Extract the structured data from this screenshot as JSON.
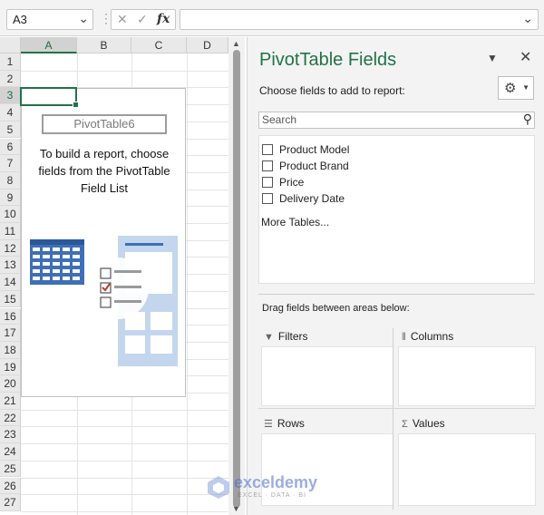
{
  "formula_bar": {
    "name_box": "A3",
    "cancel_icon": "x-icon",
    "enter_icon": "check-icon",
    "fx_label": "fx",
    "formula_value": ""
  },
  "sheet": {
    "columns": [
      "A",
      "B",
      "C",
      "D"
    ],
    "rows": [
      "1",
      "2",
      "3",
      "4",
      "5",
      "6",
      "7",
      "8",
      "9",
      "10",
      "11",
      "12",
      "13",
      "14",
      "15",
      "16",
      "17",
      "18",
      "19",
      "20",
      "21",
      "22",
      "23",
      "24",
      "25",
      "26",
      "27"
    ],
    "selected_cell": "A3",
    "pivot": {
      "name": "PivotTable6",
      "message": "To build a report, choose fields from the PivotTable Field List"
    }
  },
  "pane": {
    "title": "PivotTable Fields",
    "choose_label": "Choose fields to add to report:",
    "search_placeholder": "Search",
    "fields": [
      "Product Model",
      "Product Brand",
      "Price",
      "Delivery Date"
    ],
    "more_tables": "More Tables...",
    "drag_label": "Drag fields between areas below:",
    "areas": {
      "filters": "Filters",
      "columns": "Columns",
      "rows": "Rows",
      "values": "Values"
    }
  },
  "watermark": {
    "name": "exceldemy",
    "tagline": "EXCEL · DATA · BI"
  },
  "colors": {
    "accent": "#217346",
    "illustration_blue": "#3f6fb5",
    "illustration_light": "#c3d6ee",
    "check_red": "#c0392b"
  }
}
